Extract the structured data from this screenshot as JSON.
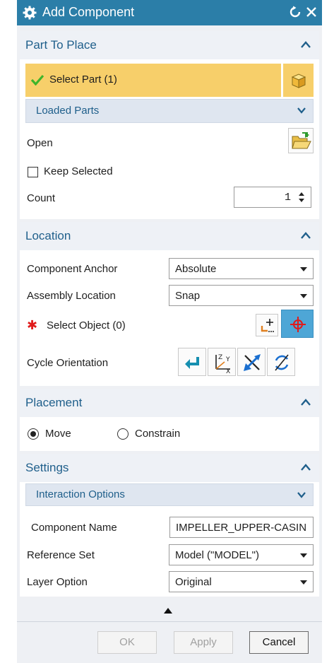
{
  "window": {
    "title": "Add Component"
  },
  "part_to_place": {
    "title": "Part To Place",
    "select_part": "Select Part (1)",
    "loaded_parts": "Loaded Parts",
    "open_label": "Open",
    "keep_selected": "Keep Selected",
    "keep_selected_checked": false,
    "count_label": "Count",
    "count_value": "1"
  },
  "location": {
    "title": "Location",
    "component_anchor_label": "Component Anchor",
    "component_anchor_value": "Absolute",
    "assembly_location_label": "Assembly Location",
    "assembly_location_value": "Snap",
    "required_mark": "✱",
    "select_object": "Select Object (0)",
    "cycle_orientation_label": "Cycle Orientation"
  },
  "placement": {
    "title": "Placement",
    "options": [
      "Move",
      "Constrain"
    ],
    "selected": "Move"
  },
  "settings": {
    "title": "Settings",
    "interaction_options": "Interaction Options",
    "component_name_label": "Component Name",
    "component_name_value": "IMPELLER_UPPER-CASIN",
    "reference_set_label": "Reference Set",
    "reference_set_value": "Model (\"MODEL\")",
    "layer_option_label": "Layer Option",
    "layer_option_value": "Original"
  },
  "footer": {
    "ok": "OK",
    "apply": "Apply",
    "cancel": "Cancel"
  },
  "colors": {
    "titlebar": "#2b7ea8",
    "group_title": "#1f5f8b",
    "selection_highlight": "#f7cf6a",
    "check": "#3fb52a",
    "required": "#e01b1b",
    "active_button": "#4ea6d6"
  }
}
